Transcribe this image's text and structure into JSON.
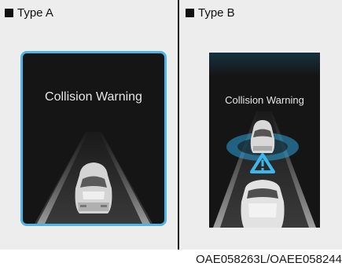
{
  "type_a": {
    "label": "Type A",
    "warning_text": "Collision Warning"
  },
  "type_b": {
    "label": "Type B",
    "warning_text": "Collision Warning"
  },
  "figure_code": "OAE058263L/OAEE058244",
  "colors": {
    "screen_border_a": "#4fb3e8",
    "warning_ring_b": "#2aa3d9",
    "screen_background": "#151515",
    "panel_background": "#ededed"
  },
  "icons": {
    "type_marker": "black-square",
    "warning": "warning-triangle-icon"
  }
}
